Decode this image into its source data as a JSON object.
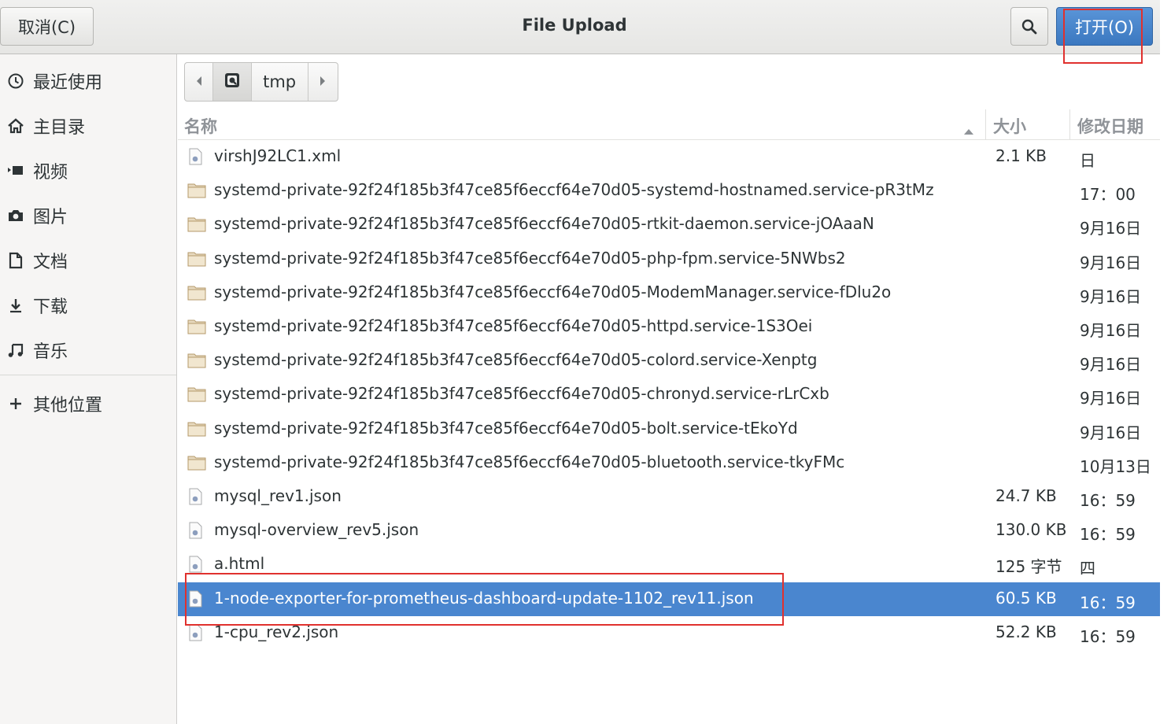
{
  "header": {
    "cancel_label": "取消(C)",
    "title": "File Upload",
    "open_label": "打开(O)",
    "search_icon": "search-icon"
  },
  "sidebar": {
    "items": [
      {
        "icon": "clock-icon",
        "label": "最近使用"
      },
      {
        "icon": "home-icon",
        "label": "主目录"
      },
      {
        "icon": "video-icon",
        "label": "视频"
      },
      {
        "icon": "camera-icon",
        "label": "图片"
      },
      {
        "icon": "document-icon",
        "label": "文档"
      },
      {
        "icon": "download-icon",
        "label": "下载"
      },
      {
        "icon": "music-icon",
        "label": "音乐"
      }
    ],
    "other_locations": {
      "icon": "plus-icon",
      "label": "其他位置"
    }
  },
  "pathbar": {
    "current": "tmp"
  },
  "columns": {
    "name": "名称",
    "size": "大小",
    "modified": "修改日期",
    "sort": "ascending"
  },
  "files": [
    {
      "type": "file",
      "name": "virshJ92LC1.xml",
      "size": "2.1 KB",
      "modified": "日"
    },
    {
      "type": "folder",
      "name": "systemd-private-92f24f185b3f47ce85f6eccf64e70d05-systemd-hostnamed.service-pR3tMz",
      "size": "",
      "modified": "17：00"
    },
    {
      "type": "folder",
      "name": "systemd-private-92f24f185b3f47ce85f6eccf64e70d05-rtkit-daemon.service-jOAaaN",
      "size": "",
      "modified": "9月16日"
    },
    {
      "type": "folder",
      "name": "systemd-private-92f24f185b3f47ce85f6eccf64e70d05-php-fpm.service-5NWbs2",
      "size": "",
      "modified": "9月16日"
    },
    {
      "type": "folder",
      "name": "systemd-private-92f24f185b3f47ce85f6eccf64e70d05-ModemManager.service-fDlu2o",
      "size": "",
      "modified": "9月16日"
    },
    {
      "type": "folder",
      "name": "systemd-private-92f24f185b3f47ce85f6eccf64e70d05-httpd.service-1S3Oei",
      "size": "",
      "modified": "9月16日"
    },
    {
      "type": "folder",
      "name": "systemd-private-92f24f185b3f47ce85f6eccf64e70d05-colord.service-Xenptg",
      "size": "",
      "modified": "9月16日"
    },
    {
      "type": "folder",
      "name": "systemd-private-92f24f185b3f47ce85f6eccf64e70d05-chronyd.service-rLrCxb",
      "size": "",
      "modified": "9月16日"
    },
    {
      "type": "folder",
      "name": "systemd-private-92f24f185b3f47ce85f6eccf64e70d05-bolt.service-tEkoYd",
      "size": "",
      "modified": "9月16日"
    },
    {
      "type": "folder",
      "name": "systemd-private-92f24f185b3f47ce85f6eccf64e70d05-bluetooth.service-tkyFMc",
      "size": "",
      "modified": "10月13日"
    },
    {
      "type": "file",
      "name": "mysql_rev1.json",
      "size": "24.7 KB",
      "modified": "16：59"
    },
    {
      "type": "file",
      "name": "mysql-overview_rev5.json",
      "size": "130.0 KB",
      "modified": "16：59"
    },
    {
      "type": "file",
      "name": "a.html",
      "size": "125 字节",
      "modified": "四"
    },
    {
      "type": "file",
      "name": "1-node-exporter-for-prometheus-dashboard-update-1102_rev11.json",
      "size": "60.5 KB",
      "modified": "16：59",
      "selected": true
    },
    {
      "type": "file",
      "name": "1-cpu_rev2.json",
      "size": "52.2 KB",
      "modified": "16：59"
    }
  ],
  "colors": {
    "selection": "#4a86cf",
    "open_button": "#3b78c0",
    "highlight_box": "#e0312e"
  }
}
